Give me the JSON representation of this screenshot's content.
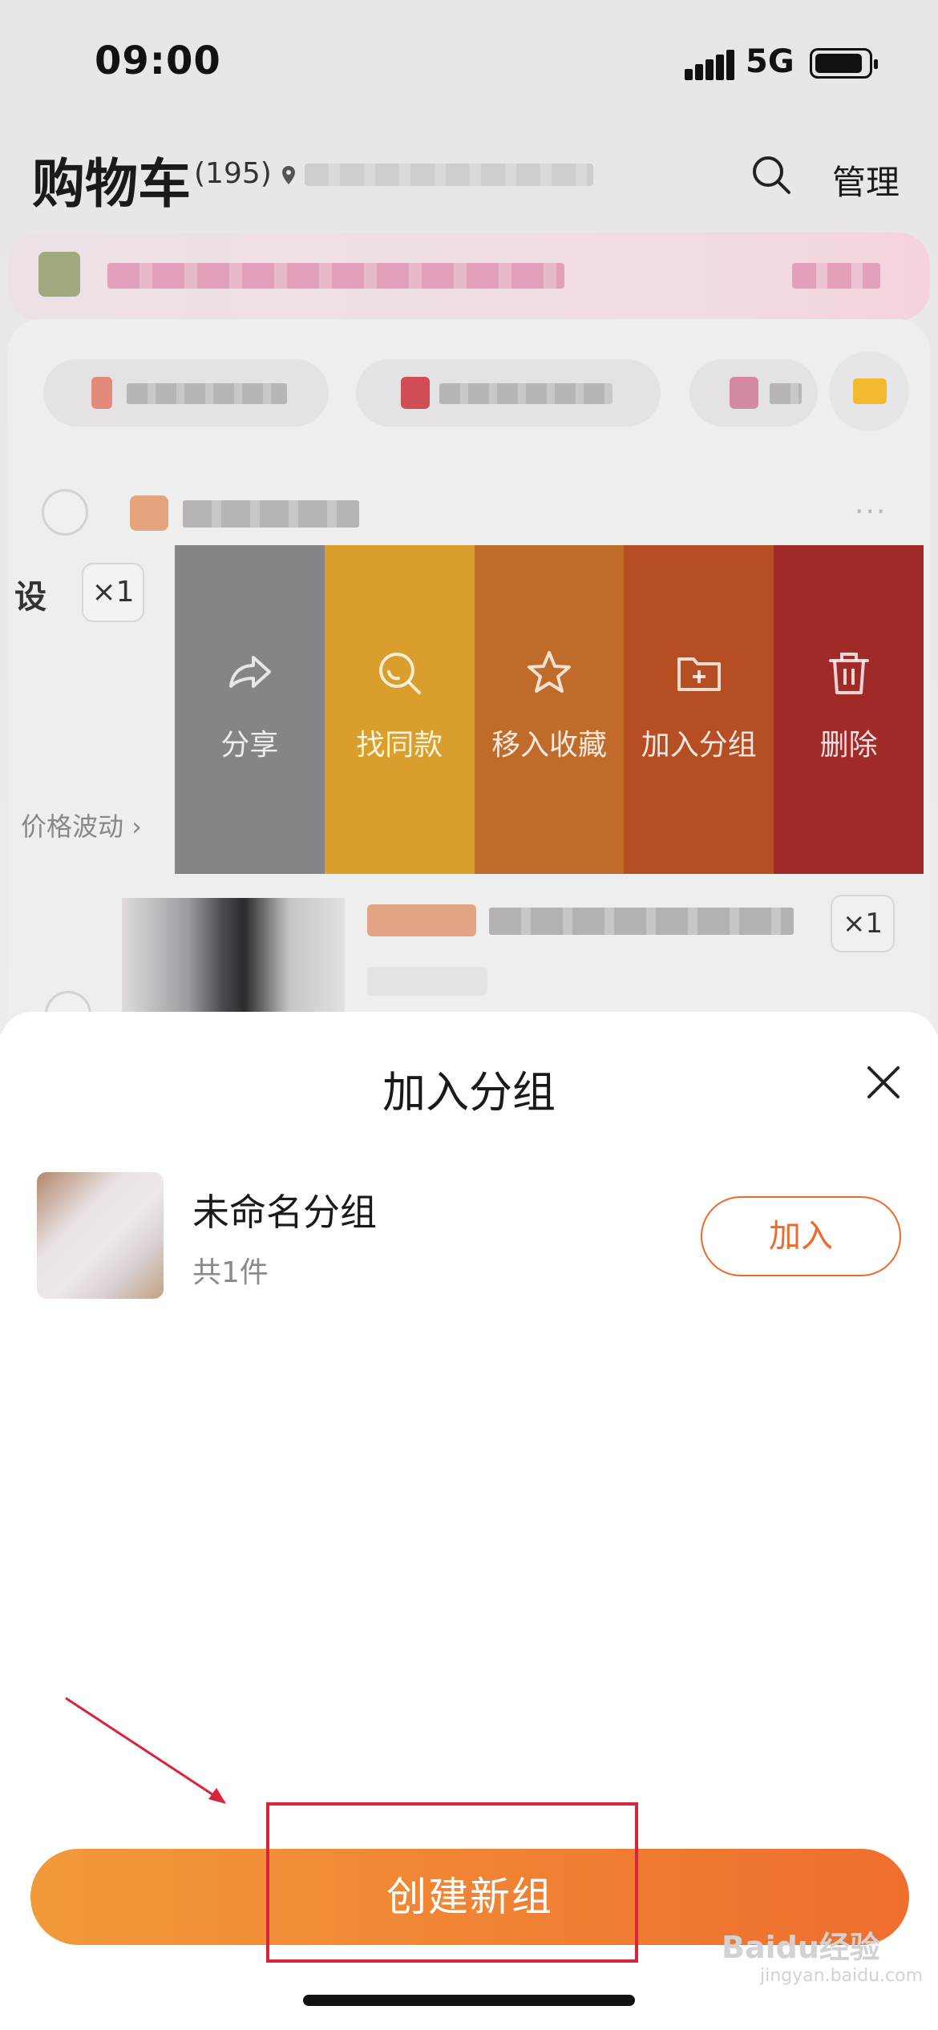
{
  "status_bar": {
    "time": "09:00",
    "network": "5G"
  },
  "header": {
    "title": "购物车",
    "count": "(195)",
    "manage_label": "管理"
  },
  "item": {
    "left_text": "设",
    "quantity": "×1",
    "price_trend_label": "价格波动 ›"
  },
  "item2": {
    "quantity": "×1"
  },
  "more_label": "···",
  "swipe_actions": [
    {
      "label": "分享",
      "icon": "share-icon",
      "color": "#858487"
    },
    {
      "label": "找同款",
      "icon": "find-similar-icon",
      "color": "#d99e2c"
    },
    {
      "label": "移入收藏",
      "icon": "star-icon",
      "color": "#c06b2a"
    },
    {
      "label": "加入分组",
      "icon": "folder-plus-icon",
      "color": "#b54f23"
    },
    {
      "label": "删除",
      "icon": "trash-icon",
      "color": "#a02a28"
    }
  ],
  "sheet": {
    "title": "加入分组",
    "groups": [
      {
        "name": "未命名分组",
        "count": "共1件",
        "action_label": "加入"
      }
    ],
    "create_button_label": "创建新组"
  },
  "colors": {
    "accent": "#ee6a2c",
    "annotation": "#d9253a"
  },
  "watermark": {
    "text": "Baidu经验",
    "sub": "jingyan.baidu.com"
  }
}
